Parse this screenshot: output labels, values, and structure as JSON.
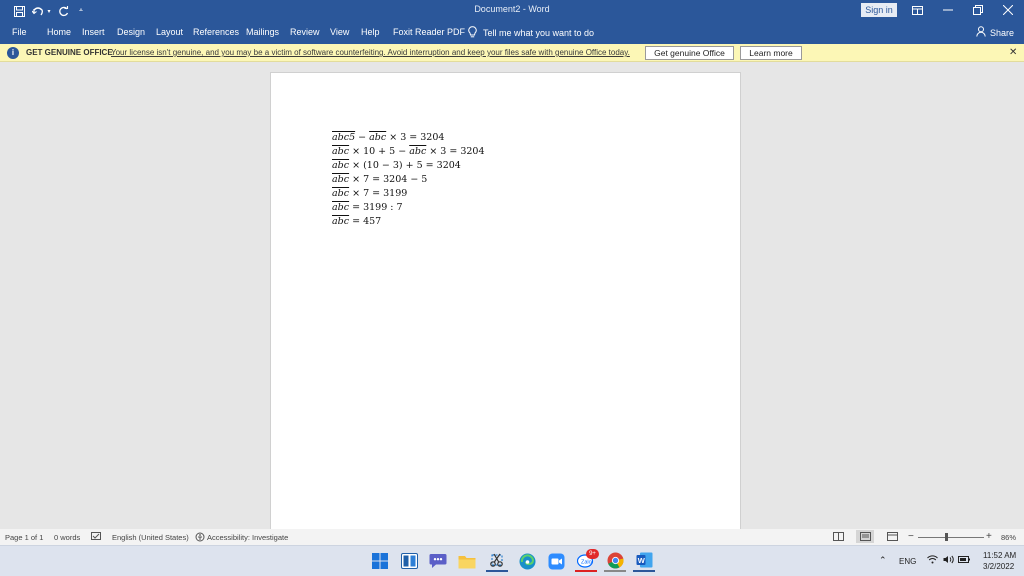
{
  "titlebar": {
    "title": "Document2  -  Word",
    "sign_in": "Sign in"
  },
  "ribbon": {
    "tabs": [
      "File",
      "Home",
      "Insert",
      "Design",
      "Layout",
      "References",
      "Mailings",
      "Review",
      "View",
      "Help",
      "Foxit Reader PDF"
    ],
    "tell_me": "Tell me what you want to do",
    "share": "Share"
  },
  "notice": {
    "heading": "GET GENUINE OFFICE",
    "message": "Your license isn't genuine, and you may be a victim of software counterfeiting. Avoid interruption and keep your files safe with genuine Office today.",
    "primary_button": "Get genuine Office",
    "secondary_button": "Learn more"
  },
  "document": {
    "equations": [
      "abc5 − abc × 3 = 3204",
      "abc × 10 + 5 − abc × 3 = 3204",
      "abc × (10 − 3) + 5 = 3204",
      "abc × 7 = 3204 − 5",
      "abc × 7 = 3199",
      "abc = 3199 : 7",
      "abc = 457"
    ]
  },
  "status": {
    "page": "Page 1 of 1",
    "words": "0 words",
    "language": "English (United States)",
    "accessibility": "Accessibility: Investigate",
    "zoom": "86%"
  },
  "taskbar": {
    "language": "ENG",
    "time": "11:52 AM",
    "date": "3/2/2022",
    "badge": "9+"
  },
  "colors": {
    "accent": "#2b579a",
    "notice_bg": "#fcf7b6"
  }
}
